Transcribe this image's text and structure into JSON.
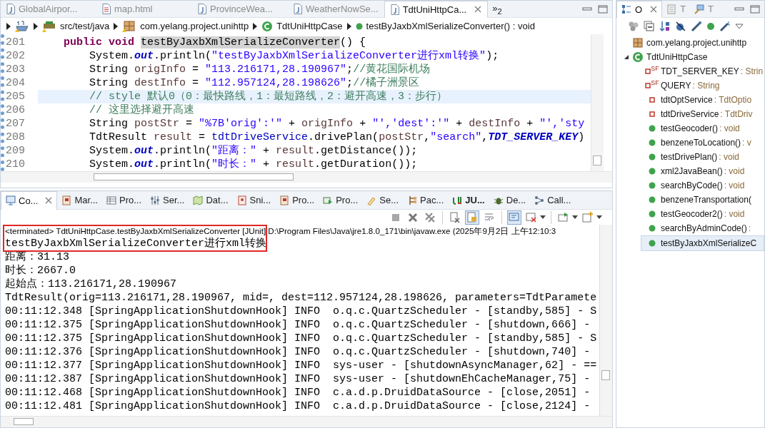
{
  "editor": {
    "tabs": [
      {
        "label": "GlobalAirpor...",
        "kind": "java",
        "selected": false
      },
      {
        "label": "map.html",
        "kind": "html",
        "selected": false
      },
      {
        "label": "ProvinceWea...",
        "kind": "java",
        "selected": false
      },
      {
        "label": "WeatherNowSe...",
        "kind": "java",
        "selected": false
      },
      {
        "label": "TdtUniHttpCa...",
        "kind": "java",
        "selected": true
      }
    ],
    "overflow": {
      "label": "»",
      "count": "2"
    },
    "breadcrumb": [
      {
        "kind": "project"
      },
      {
        "label": "src/test/java",
        "kind": "folder"
      },
      {
        "label": "com.yelang.project.unihttp",
        "kind": "package"
      },
      {
        "label": "TdtUniHttpCase",
        "kind": "class"
      },
      {
        "label": "testByJaxbXmlSerializeConverter() : void",
        "kind": "method"
      }
    ],
    "lines": [
      {
        "number": "201",
        "current": false,
        "tokens": [
          {
            "t": "    public void ",
            "kind": "kw"
          },
          {
            "t": "testByJaxbXmlSerializeConverter",
            "kind": "occurrence"
          },
          {
            "t": "() {",
            "kind": "plain"
          }
        ]
      },
      {
        "number": "202",
        "current": false,
        "tokens": [
          {
            "t": "        System.",
            "kind": "plain"
          },
          {
            "t": "out",
            "kind": "static"
          },
          {
            "t": ".println(",
            "kind": "plain"
          },
          {
            "t": "\"testByJaxbXmlSerializeConverter进行xml转换\"",
            "kind": "str"
          },
          {
            "t": ");",
            "kind": "plain"
          }
        ]
      },
      {
        "number": "203",
        "current": false,
        "tokens": [
          {
            "t": "        String ",
            "kind": "plain"
          },
          {
            "t": "origInfo",
            "kind": "var"
          },
          {
            "t": " = ",
            "kind": "plain"
          },
          {
            "t": "\"113.216171,28.190967\"",
            "kind": "str"
          },
          {
            "t": ";",
            "kind": "plain"
          },
          {
            "t": "//黄花国际机场",
            "kind": "comment"
          }
        ]
      },
      {
        "number": "204",
        "current": false,
        "tokens": [
          {
            "t": "        String ",
            "kind": "plain"
          },
          {
            "t": "destInfo",
            "kind": "var"
          },
          {
            "t": " = ",
            "kind": "plain"
          },
          {
            "t": "\"112.957124,28.198626\"",
            "kind": "str"
          },
          {
            "t": ";",
            "kind": "plain"
          },
          {
            "t": "//橘子洲景区",
            "kind": "comment"
          }
        ]
      },
      {
        "number": "205",
        "current": true,
        "tokens": [
          {
            "t": "        // style 默认0（0：最快路线，1：最短路线，2：避开高速，3：步行）",
            "kind": "comment"
          }
        ]
      },
      {
        "number": "206",
        "current": false,
        "tokens": [
          {
            "t": "        // 这里选择避开高速",
            "kind": "comment"
          }
        ]
      },
      {
        "number": "207",
        "current": false,
        "tokens": [
          {
            "t": "        String ",
            "kind": "plain"
          },
          {
            "t": "postStr",
            "kind": "var"
          },
          {
            "t": " = ",
            "kind": "plain"
          },
          {
            "t": "\"%7B'orig':'\"",
            "kind": "str"
          },
          {
            "t": " + ",
            "kind": "plain"
          },
          {
            "t": "origInfo",
            "kind": "var"
          },
          {
            "t": " + ",
            "kind": "plain"
          },
          {
            "t": "\"','dest':'\"",
            "kind": "str"
          },
          {
            "t": " + ",
            "kind": "plain"
          },
          {
            "t": "destInfo",
            "kind": "var"
          },
          {
            "t": " + ",
            "kind": "plain"
          },
          {
            "t": "\"','sty",
            "kind": "str"
          }
        ]
      },
      {
        "number": "208",
        "current": false,
        "tokens": [
          {
            "t": "        TdtResult ",
            "kind": "plain"
          },
          {
            "t": "result",
            "kind": "var"
          },
          {
            "t": " = ",
            "kind": "plain"
          },
          {
            "t": "tdtDriveService",
            "kind": "field"
          },
          {
            "t": ".drivePlan(",
            "kind": "plain"
          },
          {
            "t": "postStr",
            "kind": "var"
          },
          {
            "t": ",",
            "kind": "plain"
          },
          {
            "t": "\"search\"",
            "kind": "str"
          },
          {
            "t": ",",
            "kind": "plain"
          },
          {
            "t": "TDT_SERVER_KEY",
            "kind": "const"
          },
          {
            "t": ")",
            "kind": "plain"
          }
        ]
      },
      {
        "number": "209",
        "current": false,
        "tokens": [
          {
            "t": "        System.",
            "kind": "plain"
          },
          {
            "t": "out",
            "kind": "static"
          },
          {
            "t": ".println(",
            "kind": "plain"
          },
          {
            "t": "\"距离：\"",
            "kind": "str"
          },
          {
            "t": " + ",
            "kind": "plain"
          },
          {
            "t": "result",
            "kind": "var"
          },
          {
            "t": ".getDistance());",
            "kind": "plain"
          }
        ]
      },
      {
        "number": "210",
        "current": false,
        "tokens": [
          {
            "t": "        System.",
            "kind": "plain"
          },
          {
            "t": "out",
            "kind": "static"
          },
          {
            "t": ".println(",
            "kind": "plain"
          },
          {
            "t": "\"时长：\"",
            "kind": "str"
          },
          {
            "t": " + ",
            "kind": "plain"
          },
          {
            "t": "result",
            "kind": "var"
          },
          {
            "t": ".getDuration());",
            "kind": "plain"
          }
        ]
      }
    ]
  },
  "console": {
    "tabs": [
      {
        "label": "Co...",
        "selected": true,
        "updated": false
      },
      {
        "label": "Mar...",
        "selected": false,
        "updated": false
      },
      {
        "label": "Pro...",
        "selected": false,
        "updated": false
      },
      {
        "label": "Ser...",
        "selected": false,
        "updated": false
      },
      {
        "label": "Dat...",
        "selected": false,
        "updated": false
      },
      {
        "label": "Sni...",
        "selected": false,
        "updated": false
      },
      {
        "label": "Pro...",
        "selected": false,
        "updated": false
      },
      {
        "label": "Pro...",
        "selected": false,
        "updated": false
      },
      {
        "label": "Se...",
        "selected": false,
        "updated": false
      },
      {
        "label": "Pac...",
        "selected": false,
        "updated": false
      },
      {
        "label": "JU...",
        "selected": false,
        "updated": true
      },
      {
        "label": "De...",
        "selected": false,
        "updated": false
      },
      {
        "label": "Call...",
        "selected": false,
        "updated": false
      }
    ],
    "toolbar": [
      {
        "kind": "terminate",
        "pressed": false
      },
      {
        "kind": "remove",
        "pressed": false
      },
      {
        "kind": "remove_all",
        "pressed": false
      },
      {
        "kind": "clear",
        "pressed": false
      },
      {
        "kind": "scroll_lock",
        "pressed": true
      },
      {
        "kind": "word_wrap",
        "pressed": false
      },
      {
        "kind": "pin",
        "pressed": true
      },
      {
        "kind": "display",
        "pressed": false
      },
      {
        "kind": "open",
        "pressed": false
      },
      {
        "kind": "new",
        "pressed": false
      }
    ],
    "header": "<terminated> TdtUniHttpCase.testByJaxbXmlSerializeConverter [JUnit] D:\\Program Files\\Java\\jre1.8.0_171\\bin\\javaw.exe (2025年9月2日 上午12:10:3",
    "annotation": {
      "kind": "rectangle"
    },
    "lines": [
      "testByJaxbXmlSerializeConverter进行xml转换",
      "距离：31.13",
      "时长：2667.0",
      "起始点：113.216171,28.190967",
      "TdtResult(orig=113.216171,28.190967, mid=, dest=112.957124,28.198626, parameters=TdtParamete",
      "00:11:12.348 [SpringApplicationShutdownHook] INFO  o.q.c.QuartzScheduler - [standby,585] - S",
      "00:11:12.375 [SpringApplicationShutdownHook] INFO  o.q.c.QuartzScheduler - [shutdown,666] -",
      "00:11:12.375 [SpringApplicationShutdownHook] INFO  o.q.c.QuartzScheduler - [standby,585] - S",
      "00:11:12.376 [SpringApplicationShutdownHook] INFO  o.q.c.QuartzScheduler - [shutdown,740] -",
      "00:11:12.377 [SpringApplicationShutdownHook] INFO  sys-user - [shutdownAsyncManager,62] - ==",
      "00:11:12.387 [SpringApplicationShutdownHook] INFO  sys-user - [shutdownEhCacheManager,75] -",
      "00:11:12.468 [SpringApplicationShutdownHook] INFO  c.a.d.p.DruidDataSource - [close,2051] -",
      "00:11:12.481 [SpringApplicationShutdownHook] INFO  c.a.d.p.DruidDataSource - [close,2124] -"
    ]
  },
  "outline": {
    "tabs": [
      {
        "label": "O",
        "selected": true
      },
      {
        "label": "T",
        "selected": false
      },
      {
        "label": "T",
        "selected": false
      }
    ],
    "tree": [
      {
        "label": "com.yelang.project.unihttp",
        "kind": "package",
        "selected": false
      },
      {
        "label": "TdtUniHttpCase",
        "kind": "class",
        "selected": false,
        "expanded": true,
        "children": [
          {
            "label": "TDT_SERVER_KEY",
            "type": ": Strin",
            "kind": "constant",
            "modifiers": "SF",
            "selected": false
          },
          {
            "label": "QUERY",
            "type": ": String",
            "kind": "constant",
            "modifiers": "SF",
            "selected": false
          },
          {
            "label": "tdtOptService",
            "type": ": TdtOptio",
            "kind": "field",
            "selected": false
          },
          {
            "label": "tdtDriveService",
            "type": ": TdtDriv",
            "kind": "field",
            "selected": false
          },
          {
            "label": "testGeocoder()",
            "type": ": void",
            "kind": "method",
            "selected": false
          },
          {
            "label": "benzeneToLocation()",
            "type": ": v",
            "kind": "method",
            "selected": false
          },
          {
            "label": "testDrivePlan()",
            "type": ": void",
            "kind": "method",
            "selected": false
          },
          {
            "label": "xml2JavaBean()",
            "type": ": void",
            "kind": "method",
            "selected": false
          },
          {
            "label": "searchByCode()",
            "type": ": void",
            "kind": "method",
            "selected": false
          },
          {
            "label": "benzeneTransportation(",
            "kind": "method",
            "selected": false
          },
          {
            "label": "testGeocoder2()",
            "type": ": void",
            "kind": "method",
            "selected": false
          },
          {
            "label": "searchByAdminCode()",
            "type": ":",
            "kind": "method",
            "selected": false
          },
          {
            "label": "testByJaxbXmlSerializeC",
            "kind": "method",
            "selected": true
          }
        ]
      }
    ]
  }
}
